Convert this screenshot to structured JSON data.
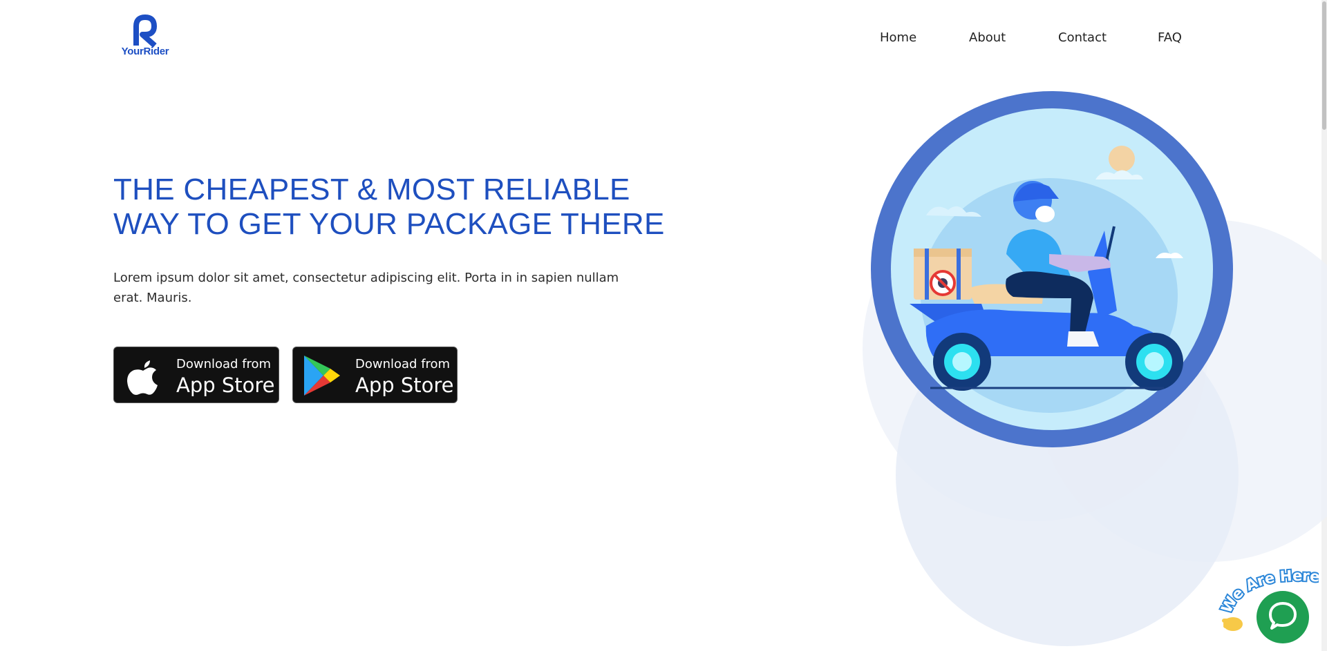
{
  "brand": {
    "name": "YourRider",
    "color": "#1d4fc4"
  },
  "nav": {
    "items": [
      {
        "label": "Home"
      },
      {
        "label": "About"
      },
      {
        "label": "Contact"
      },
      {
        "label": "FAQ"
      }
    ]
  },
  "hero": {
    "title_line1": "THE CHEAPEST & MOST RELIABLE",
    "title_line2": "WAY TO GET YOUR PACKAGE THERE",
    "description": "Lorem ipsum dolor sit amet, consectetur adipiscing elit. Porta in in sapien nullam erat. Mauris.",
    "title_color": "#1e4fbf"
  },
  "downloads": [
    {
      "small_label": "Download from",
      "big_label": "App Store",
      "icon": "apple-icon"
    },
    {
      "small_label": "Download from",
      "big_label": "App Store",
      "icon": "google-play-icon"
    }
  ],
  "chat_widget": {
    "badge_text": "We Are Here!",
    "icon": "chat-icon",
    "color": "#1f9f52"
  }
}
